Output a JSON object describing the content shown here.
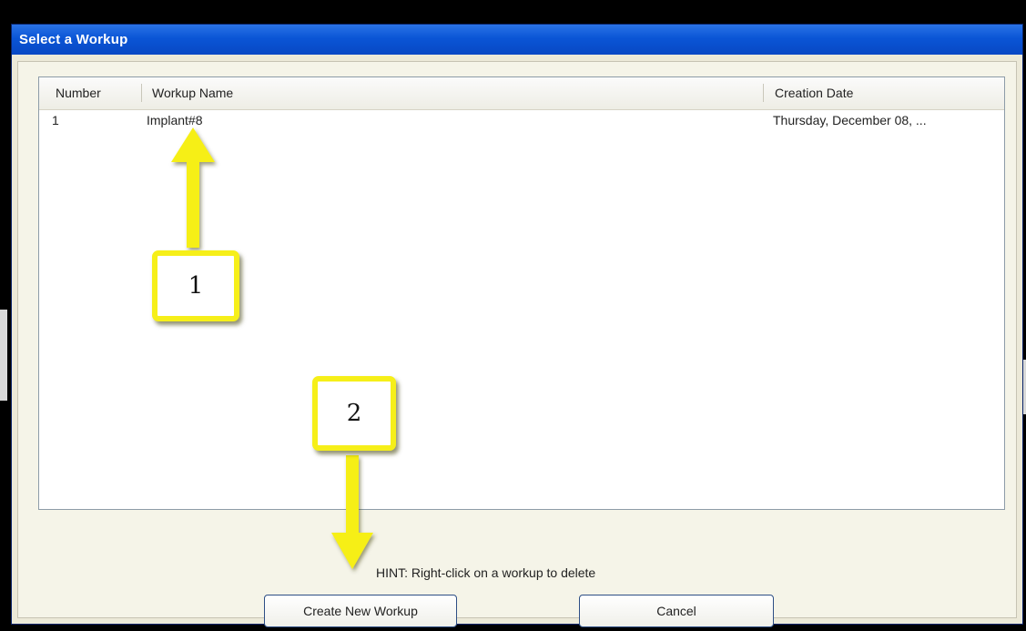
{
  "dialog": {
    "title": "Select a Workup",
    "columns": [
      "Number",
      "Workup Name",
      "Creation Date"
    ],
    "rows": [
      {
        "number": "1",
        "name": "Implant#8",
        "date": "Thursday, December 08, ..."
      }
    ],
    "hint": "HINT: Right-click on a workup to delete",
    "buttons": {
      "create": "Create New Workup",
      "cancel": "Cancel"
    }
  },
  "annotations": {
    "badge1": "1",
    "badge2": "2",
    "highlight_color": "#f6ef19"
  }
}
